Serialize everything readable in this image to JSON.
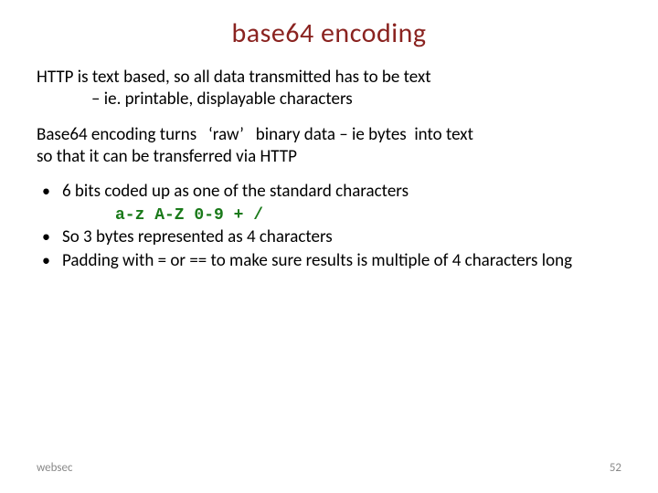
{
  "title": "base64 encoding",
  "para1": {
    "line1": "HTTP is text based, so all data transmitted has to be text",
    "line2": "– ie. printable, displayable characters"
  },
  "para2": {
    "line1": "Base64 encoding turns   ‘raw’   binary data – ie bytes  into text",
    "line2": "so that it can be transferred via HTTP"
  },
  "bullets": {
    "b1": "6 bits coded up as one of the standard characters",
    "b1_code": "a-z A-Z 0-9 + /",
    "b2": "So 3 bytes represented as 4 characters",
    "b3": "Padding with = or == to make sure results is multiple of 4 characters long"
  },
  "footer": "websec",
  "page_number": "52"
}
